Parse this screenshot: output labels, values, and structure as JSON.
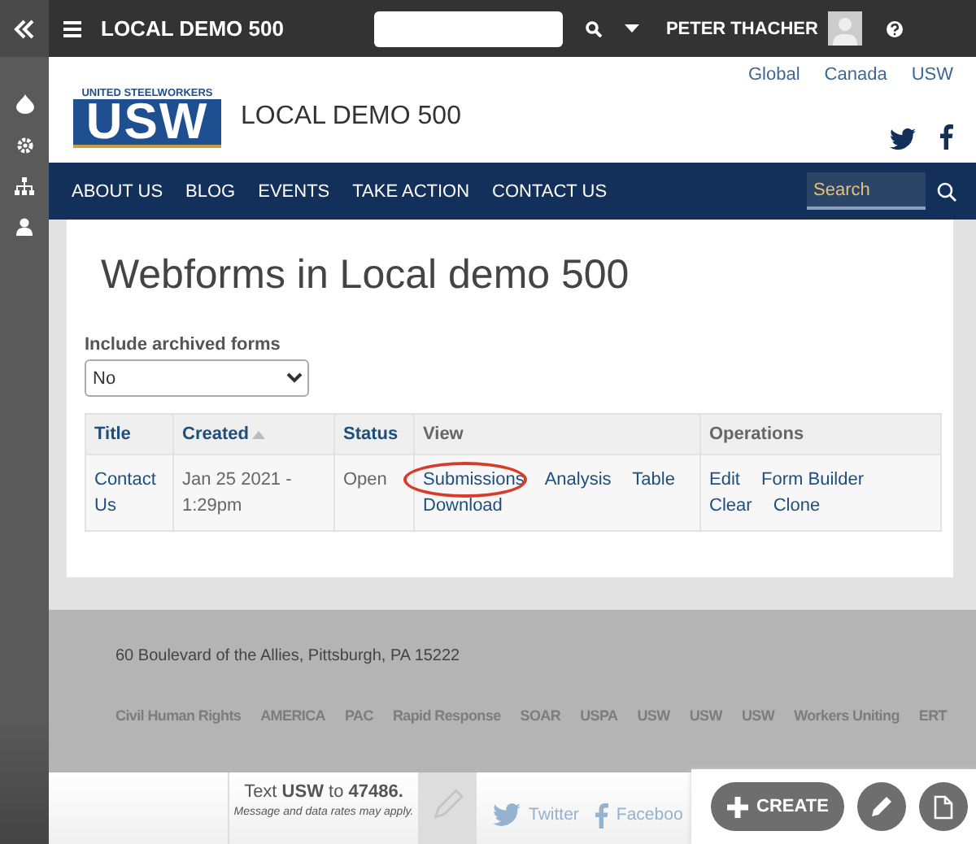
{
  "topbar": {
    "site_name": "LOCAL DEMO 500",
    "user_name": "PETER THACHER"
  },
  "header": {
    "links": [
      "Global",
      "Canada",
      "USW"
    ],
    "logo": {
      "tagline": "UNITED STEELWORKERS",
      "mark": "USW"
    },
    "site_name": "LOCAL DEMO 500"
  },
  "nav": {
    "items": [
      "ABOUT US",
      "BLOG",
      "EVENTS",
      "TAKE ACTION",
      "CONTACT US"
    ],
    "search": {
      "placeholder": "Search"
    }
  },
  "page": {
    "title": "Webforms in Local demo 500",
    "filter": {
      "label": "Include archived forms",
      "value": "No"
    },
    "table": {
      "columns": [
        {
          "label": "Title",
          "sortable": true,
          "sorted": false
        },
        {
          "label": "Created",
          "sortable": true,
          "sorted": true
        },
        {
          "label": "Status",
          "sortable": true,
          "sorted": false
        },
        {
          "label": "View",
          "sortable": false,
          "sorted": false
        },
        {
          "label": "Operations",
          "sortable": false,
          "sorted": false
        }
      ],
      "rows": [
        {
          "title": "Contact Us",
          "created": "Jan 25 2021 - 1:29pm",
          "status": "Open",
          "view": [
            {
              "label": "Submissions",
              "circled": true
            },
            {
              "label": "Analysis",
              "circled": false
            },
            {
              "label": "Table",
              "circled": false
            },
            {
              "label": "Download",
              "circled": false
            }
          ],
          "operations": [
            {
              "label": "Edit",
              "circled": false
            },
            {
              "label": "Form Builder",
              "circled": false
            },
            {
              "label": "Clear",
              "circled": false
            },
            {
              "label": "Clone",
              "circled": false
            }
          ]
        }
      ]
    }
  },
  "footer": {
    "address": "60 Boulevard of the Allies, Pittsburgh, PA 15222",
    "logos": [
      "Civil Human Rights",
      "AMERICA",
      "PAC",
      "Rapid Response",
      "SOAR",
      "USPA",
      "USW",
      "USW",
      "USW",
      "Workers Uniting",
      "ERT"
    ]
  },
  "bottom_bar": {
    "sms": "Text **USW** to **47486.**",
    "note": "Message and data rates may apply.",
    "social": [
      "Twitter",
      "Faceboo"
    ],
    "create": "CREATE"
  }
}
